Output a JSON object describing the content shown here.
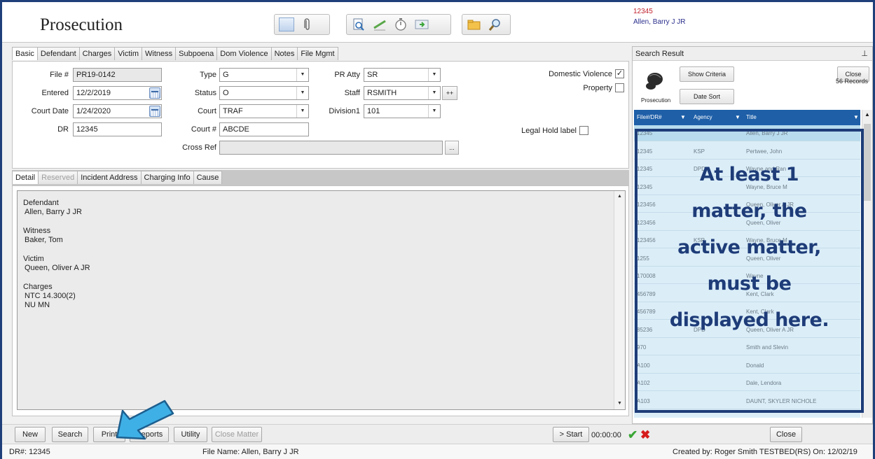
{
  "header": {
    "title": "Prosecution",
    "file_number": "12345",
    "defendant_name": "Allen, Barry J JR"
  },
  "tabs": [
    "Basic",
    "Defendant",
    "Charges",
    "Victim",
    "Witness",
    "Subpoena",
    "Dom Violence",
    "Notes",
    "File Mgmt"
  ],
  "form": {
    "file_label": "File #",
    "file_value": "PR19-0142",
    "entered_label": "Entered",
    "entered_value": "12/2/2019",
    "court_date_label": "Court Date",
    "court_date_value": "1/24/2020",
    "dr_label": "DR",
    "dr_value": "12345",
    "type_label": "Type",
    "type_value": "G",
    "status_label": "Status",
    "status_value": "O",
    "court_label": "Court",
    "court_value": "TRAF",
    "court_num_label": "Court #",
    "court_num_value": "ABCDE",
    "cross_ref_label": "Cross Ref",
    "cross_ref_value": "",
    "pr_atty_label": "PR Atty",
    "pr_atty_value": "SR",
    "staff_label": "Staff",
    "staff_value": "RSMITH",
    "division_label": "Division1",
    "division_value": "101",
    "plus_label": "++",
    "ellipsis_label": "...",
    "domestic_violence_label": "Domestic Violence",
    "domestic_violence_checked": "✓",
    "property_label": "Property",
    "legal_hold_label": "Legal Hold label"
  },
  "detail_tabs": [
    "Detail",
    "Reserved",
    "Incident Address",
    "Charging Info",
    "Cause"
  ],
  "detail": {
    "defendant_heading": "Defendant",
    "defendant_value": "Allen, Barry J JR",
    "witness_heading": "Witness",
    "witness_value": "Baker, Tom",
    "victim_heading": "Victim",
    "victim_value": "Queen, Oliver A JR",
    "charges_heading": "Charges",
    "charges_line1": "NTC 14.300(2)",
    "charges_line2": "NU MN"
  },
  "search_result": {
    "title": "Search Result",
    "show_criteria": "Show Criteria",
    "date_sort": "Date Sort",
    "close": "Close",
    "records": "56 Records",
    "icon_caption": "Prosecution",
    "columns": [
      "File#/DR#",
      "Agency",
      "Title"
    ],
    "rows": [
      {
        "file": "12345",
        "agency": "",
        "title": "Allen, Barry J JR"
      },
      {
        "file": "12345",
        "agency": "KSP",
        "title": "Pertwee, John"
      },
      {
        "file": "12345",
        "agency": "DPD",
        "title": "Wayne and Ran"
      },
      {
        "file": "12345",
        "agency": "",
        "title": "Wayne, Bruce M"
      },
      {
        "file": "123456",
        "agency": "",
        "title": "Queen, Oliver A JR"
      },
      {
        "file": "123456",
        "agency": "",
        "title": "Queen, Oliver"
      },
      {
        "file": "123456",
        "agency": "KSP",
        "title": "Wayne, Bruce M"
      },
      {
        "file": "1255",
        "agency": "",
        "title": "Queen, Oliver"
      },
      {
        "file": "170008",
        "agency": "",
        "title": "Wayne"
      },
      {
        "file": "456789",
        "agency": "",
        "title": "Kent, Clark"
      },
      {
        "file": "456789",
        "agency": "",
        "title": "Kent, Clark"
      },
      {
        "file": "85236",
        "agency": "DPD",
        "title": "Queen, Oliver A JR"
      },
      {
        "file": "970",
        "agency": "",
        "title": "Smith and Slevin"
      },
      {
        "file": "A100",
        "agency": "",
        "title": "Donald"
      },
      {
        "file": "A102",
        "agency": "",
        "title": "Dale, Lendora"
      },
      {
        "file": "A103",
        "agency": "",
        "title": "DAUNT, SKYLER NICHOLE"
      }
    ]
  },
  "annotation": {
    "lines": [
      "At least 1",
      "matter, the",
      "active matter,",
      "must be",
      "displayed here."
    ]
  },
  "toolbar": {
    "new": "New",
    "search": "Search",
    "print": "Print",
    "reports": "Reports",
    "utility": "Utility",
    "close_matter": "Close Matter",
    "start": "> Start",
    "timer": "00:00:00",
    "close": "Close"
  },
  "statusbar": {
    "dr": "DR#: 12345",
    "file_name": "File Name: Allen, Barry J JR",
    "created": "Created by: Roger Smith TESTBED(RS) On: 12/02/19"
  },
  "colors": {
    "annotation": "#1e3c78",
    "grid_header": "#1e5fa8",
    "grid_body": "#dbeef8",
    "arrow": "#3fb0e6",
    "file_number_red": "#c0202b",
    "defendant_blue": "#2a2e8c"
  }
}
